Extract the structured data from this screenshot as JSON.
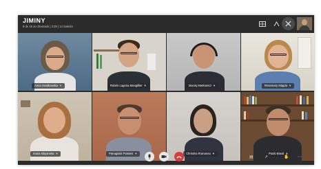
{
  "meeting": {
    "title": "JIMINY",
    "subtitle": "9 de 15 ao chamado | 3:29 | 14 Galería"
  },
  "toolbar": {
    "grid_icon": "grid-view-icon",
    "share_icon": "share-screen-icon",
    "round_icon": "add-participant-icon"
  },
  "participants": [
    {
      "name": "Anna Sowikowska"
    },
    {
      "name": "Rubén Lagona Mongillier"
    },
    {
      "name": "Maciej Markowicz"
    },
    {
      "name": "Rosemary Mágda"
    },
    {
      "name": "maria sbiyaneka"
    },
    {
      "name": "Panagiotis Posseis"
    },
    {
      "name": "Christina Romanou"
    },
    {
      "name": "Paolo Brasii"
    }
  ],
  "controls": {
    "mic_icon": "microphone-icon",
    "camera_icon": "camera-icon",
    "end_call_icon": "end-call-icon",
    "chat_icon": "chat-icon",
    "share_icon": "share-icon",
    "hand_icon": "raise-hand-icon",
    "more_icon": "more-icon"
  },
  "colors": {
    "end_call": "#d63c3c",
    "raise_hand": "#e06b8b"
  }
}
